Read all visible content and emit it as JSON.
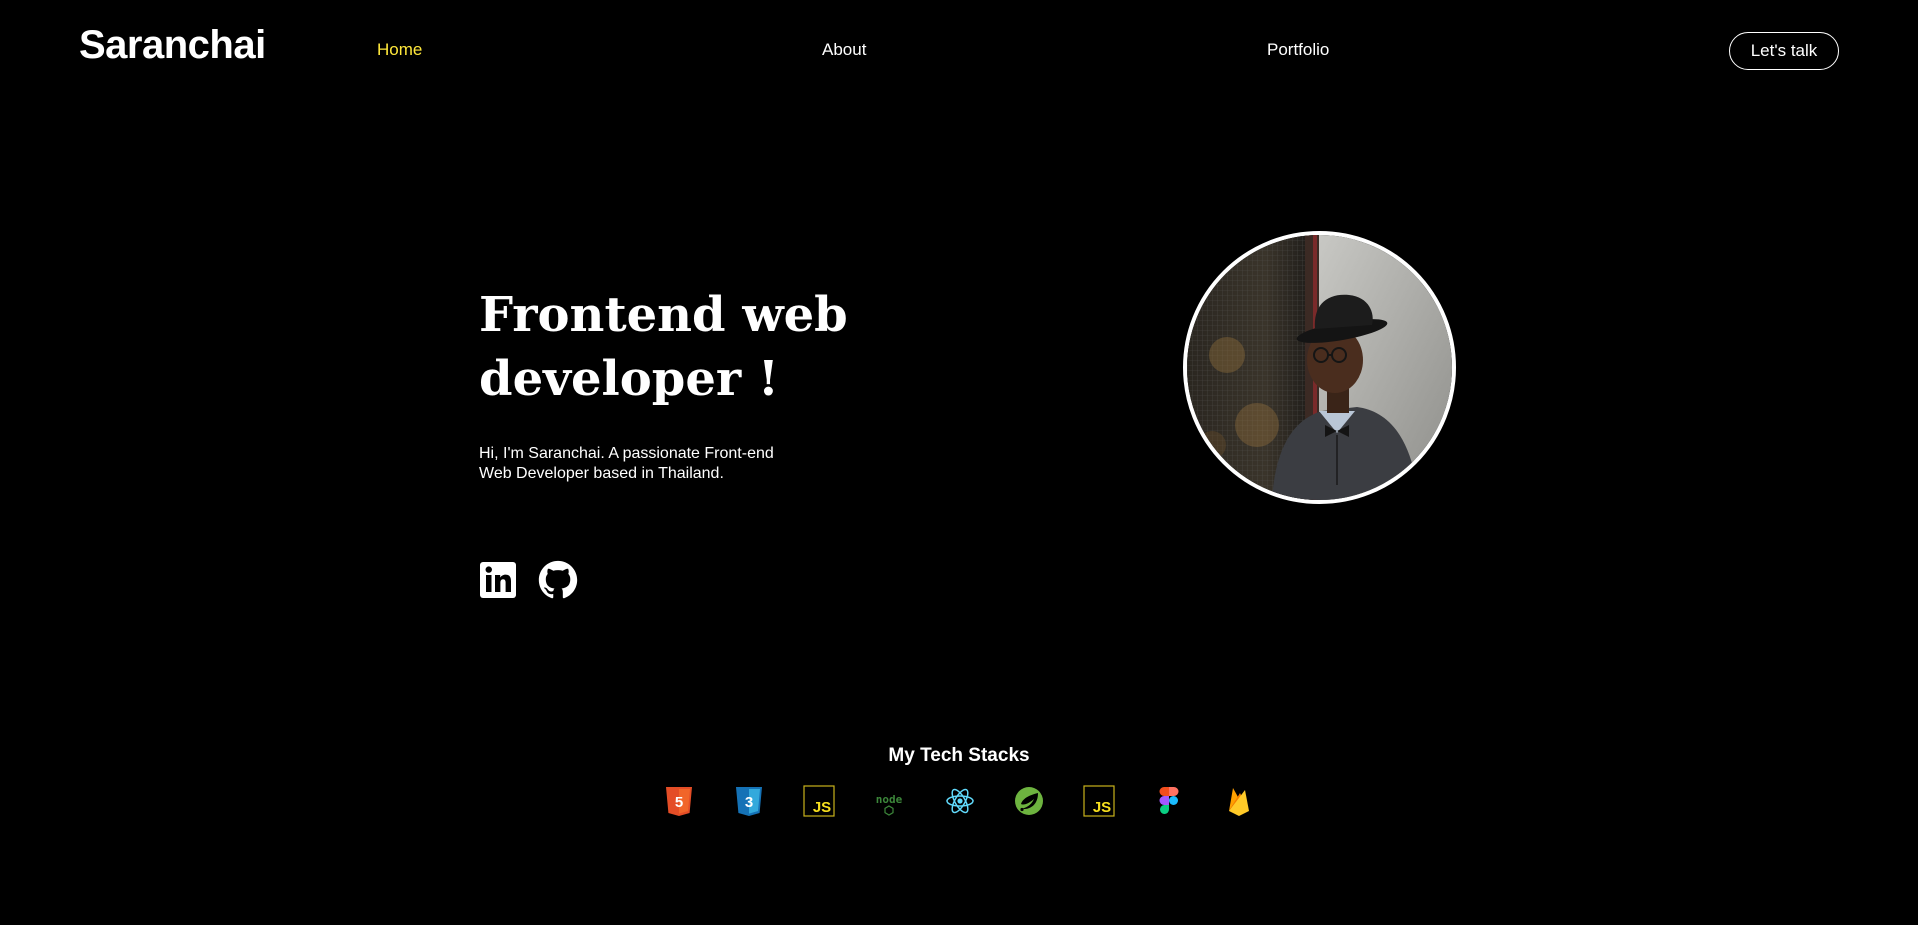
{
  "nav": {
    "brand": "Saranchai",
    "links": [
      {
        "label": "Home",
        "active": true
      },
      {
        "label": "About",
        "active": false
      },
      {
        "label": "Portfolio",
        "active": false
      }
    ],
    "cta_label": "Let's talk"
  },
  "hero": {
    "title_line1": "Frontend web",
    "title_line2": "developer !",
    "intro_line1": "Hi, I'm Saranchai. A passionate Front-end",
    "intro_line2": "Web Developer based in Thailand.",
    "socials": [
      {
        "icon": "linkedin-icon"
      },
      {
        "icon": "github-icon"
      }
    ],
    "avatar": "profile-photo"
  },
  "tech_stacks": {
    "title": "My Tech Stacks",
    "icons": [
      {
        "icon": "html5-icon",
        "text": "5",
        "color": "#e44d26"
      },
      {
        "icon": "css3-icon",
        "text": "3",
        "color": "#1572b6"
      },
      {
        "icon": "javascript-icon",
        "text": "JS",
        "color": "#f7df1e"
      },
      {
        "icon": "nodejs-icon",
        "text": "node",
        "color": "#3c873a"
      },
      {
        "icon": "react-icon",
        "text": "",
        "color": "#61dafb"
      },
      {
        "icon": "spring-icon",
        "text": "",
        "color": "#6db33f"
      },
      {
        "icon": "javascript-icon",
        "text": "JS",
        "color": "#f7df1e"
      },
      {
        "icon": "figma-icon",
        "text": "",
        "color": "#a259ff"
      },
      {
        "icon": "firebase-icon",
        "text": "",
        "color": "#ffca28"
      }
    ]
  },
  "colors": {
    "background": "#000000",
    "text": "#ffffff",
    "accent": "#ffe83b"
  }
}
